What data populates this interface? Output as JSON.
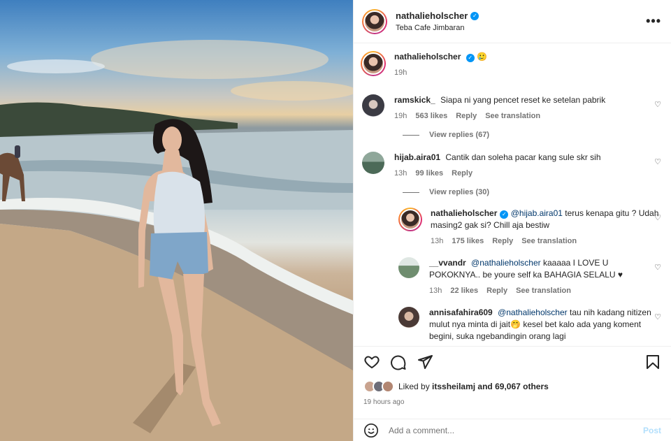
{
  "header": {
    "username": "nathalieholscher",
    "location": "Teba Cafe Jimbaran",
    "more_icon": "more-horizontal-icon"
  },
  "caption": {
    "username": "nathalieholscher",
    "emoji": "🥲",
    "time": "19h"
  },
  "comments": [
    {
      "username": "ramskick_",
      "text": "Siapa ni yang pencet reset ke setelan pabrik",
      "time": "19h",
      "likes": "563 likes",
      "reply": "Reply",
      "see_translation": "See translation",
      "view_replies": "View replies (67)"
    },
    {
      "username": "hijab.aira01",
      "text": "Cantik dan soleha pacar kang sule skr sih",
      "time": "13h",
      "likes": "99 likes",
      "reply": "Reply",
      "view_replies": "View replies (30)",
      "replies": [
        {
          "username": "nathalieholscher",
          "mention": "@hijab.aira01",
          "text": "terus kenapa gitu ? Udah masing2 gak si? Chill aja bestiw",
          "time": "13h",
          "likes": "175 likes",
          "reply": "Reply",
          "see_translation": "See translation"
        },
        {
          "username": "__vvandr",
          "mention": "@nathalieholscher",
          "text": "kaaaaa I LOVE U POKOKNYA.. be youre self ka BAHAGIA SELALU ♥",
          "time": "13h",
          "likes": "22 likes",
          "reply": "Reply",
          "see_translation": "See translation"
        },
        {
          "username": "annisafahira609",
          "mention": "@nathalieholscher",
          "text": "tau nih kadang nitizen mulut nya minta di jait🤭 kesel bet kalo ada yang koment begini, suka ngebandingin orang lagi"
        }
      ]
    }
  ],
  "actions": {
    "like_icon": "heart-icon",
    "comment_icon": "comment-icon",
    "share_icon": "share-icon",
    "save_icon": "bookmark-icon",
    "liked_by_prefix": "Liked by",
    "liked_by_user": "itssheilamj",
    "liked_by_suffix": "and 69,067 others",
    "timestamp": "19 hours ago"
  },
  "add_comment": {
    "emoji_icon": "emoji-icon",
    "placeholder": "Add a comment...",
    "post_label": "Post"
  }
}
